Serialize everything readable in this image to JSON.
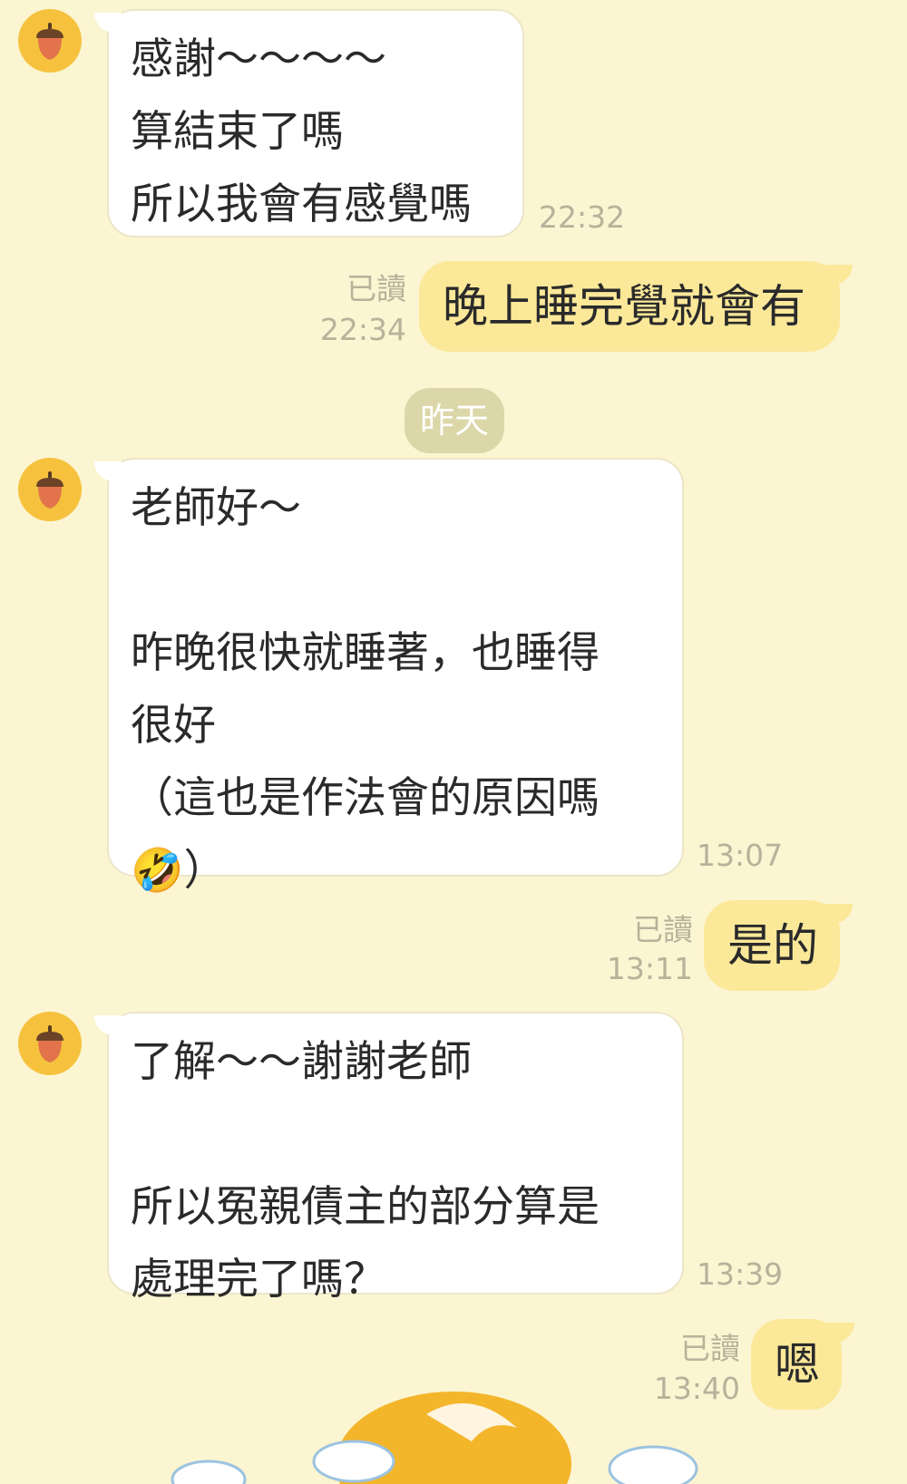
{
  "messages": [
    {
      "side": "in",
      "text": "感謝～～～～\n算結束了嗎\n所以我會有感覺嗎",
      "time": "22:32"
    },
    {
      "side": "out",
      "text": "晚上睡完覺就會有",
      "read": "已讀",
      "time": "22:34"
    },
    {
      "side": "in",
      "text": "老師好～\n\n昨晚很快就睡著，也睡得\n很好\n（這也是作法會的原因嗎\n🤣）",
      "time": "13:07"
    },
    {
      "side": "out",
      "text": "是的",
      "read": "已讀",
      "time": "13:11"
    },
    {
      "side": "in",
      "text": "了解～～謝謝老師\n\n所以冤親債主的部分算是\n處理完了嗎？",
      "time": "13:39"
    },
    {
      "side": "out",
      "text": "嗯",
      "read": "已讀",
      "time": "13:40"
    }
  ],
  "date_separator": "昨天",
  "avatar_icon": "acorn-icon",
  "colors": {
    "background": "#fbf5d2",
    "incoming_bubble": "#ffffff",
    "outgoing_bubble": "#fbe899",
    "avatar": "#f6c23e",
    "meta_text": "#b7b29a"
  }
}
